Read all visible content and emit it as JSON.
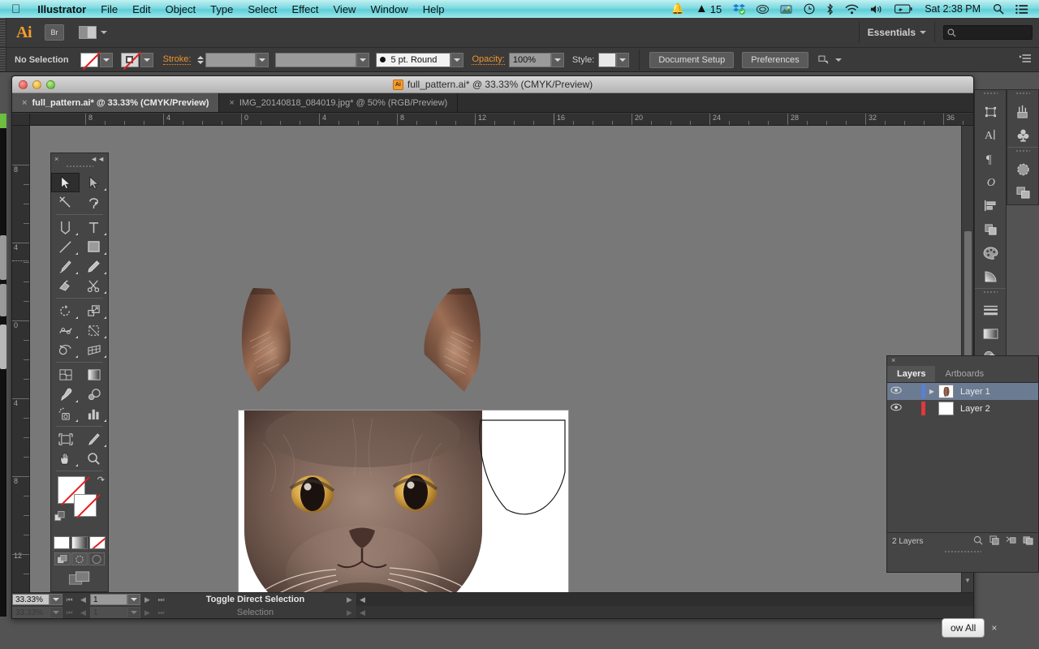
{
  "menubar": {
    "apple_icon": "apple-icon",
    "items": [
      {
        "label": "Illustrator",
        "bold": true
      },
      {
        "label": "File",
        "bold": false
      },
      {
        "label": "Edit",
        "bold": false
      },
      {
        "label": "Object",
        "bold": false
      },
      {
        "label": "Type",
        "bold": false
      },
      {
        "label": "Select",
        "bold": false
      },
      {
        "label": "Effect",
        "bold": false
      },
      {
        "label": "View",
        "bold": false
      },
      {
        "label": "Window",
        "bold": false
      },
      {
        "label": "Help",
        "bold": false
      }
    ],
    "status_icons": [
      "notification-bell-icon",
      "adobe-app-icon",
      "dropbox-icon",
      "creative-cloud-icon",
      "screenshot-app-icon",
      "time-machine-icon",
      "bluetooth-icon",
      "wifi-icon",
      "volume-icon",
      "battery-icon"
    ],
    "adobe_badge": "15",
    "clock": "Sat 2:38 PM",
    "search_icon": "spotlight-search-icon",
    "list_icon": "notification-center-icon",
    "accent_color": "#7fd9e0"
  },
  "appbar": {
    "logo": "Ai",
    "bridge_label": "Br",
    "arrange_icon": "arrange-documents-icon",
    "workspace": "Essentials",
    "search_placeholder": "",
    "search_icon": "search-icon"
  },
  "controlbar": {
    "selection_status": "No Selection",
    "fill_label": "fill-swatch-none",
    "stroke_swatch_label": "stroke-swatch-none",
    "stroke_label": "Stroke:",
    "stroke_weight": "",
    "stroke_profile": "",
    "brush_definition": "5 pt. Round",
    "opacity_label": "Opacity:",
    "opacity_value": "100%",
    "style_label": "Style:",
    "document_setup": "Document Setup",
    "preferences": "Preferences",
    "transform_icon": "transform-icon",
    "panel_menu_icon": "panel-menu-icon"
  },
  "document": {
    "title": "full_pattern.ai* @ 33.33% (CMYK/Preview)",
    "title_icon": "ai-document-icon",
    "tabs": [
      {
        "label": "full_pattern.ai* @ 33.33% (CMYK/Preview)",
        "active": true
      },
      {
        "label": "IMG_20140818_084019.jpg* @ 50% (RGB/Preview)",
        "active": false
      }
    ],
    "close_glyph": "×"
  },
  "rulers": {
    "horizontal_ticks": [
      "8",
      "4",
      "0",
      "4",
      "8",
      "12",
      "16",
      "20",
      "24",
      "28",
      "32",
      "36"
    ],
    "vertical_ticks": [
      "8",
      "4",
      "0",
      "4",
      "8",
      "12"
    ],
    "units": "inches"
  },
  "canvas": {
    "artboard_label": "artboard-1",
    "artwork": [
      {
        "name": "cat-left-ear",
        "type": "raster-image"
      },
      {
        "name": "cat-right-ear",
        "type": "raster-image"
      },
      {
        "name": "cat-face",
        "type": "clipped-raster-image"
      },
      {
        "name": "ear-outline-path",
        "type": "vector-path"
      }
    ]
  },
  "statusbar": {
    "zoom": "33.33%",
    "page": "1",
    "tool_hint": "Toggle Direct Selection",
    "tool_hint_secondary": "Selection",
    "nav_first": "first-page-icon",
    "nav_prev": "previous-page-icon",
    "nav_next": "next-page-icon",
    "nav_last": "last-page-icon"
  },
  "toolbox": {
    "close_glyph": "×",
    "collapse_glyph": "◄◄",
    "tools": [
      {
        "name": "selection-tool",
        "selected": true,
        "flyout": false
      },
      {
        "name": "direct-selection-tool",
        "selected": false,
        "flyout": true
      },
      {
        "name": "magic-wand-tool",
        "selected": false,
        "flyout": false
      },
      {
        "name": "lasso-tool",
        "selected": false,
        "flyout": false
      },
      {
        "name": "pen-tool",
        "selected": false,
        "flyout": true
      },
      {
        "name": "type-tool",
        "selected": false,
        "flyout": true
      },
      {
        "name": "line-segment-tool",
        "selected": false,
        "flyout": true
      },
      {
        "name": "rectangle-tool",
        "selected": false,
        "flyout": true
      },
      {
        "name": "paintbrush-tool",
        "selected": false,
        "flyout": true
      },
      {
        "name": "pencil-tool",
        "selected": false,
        "flyout": true
      },
      {
        "name": "blob-brush-tool",
        "selected": false,
        "flyout": false
      },
      {
        "name": "eraser-scissors-tool",
        "selected": false,
        "flyout": true
      },
      {
        "name": "rotate-tool",
        "selected": false,
        "flyout": true
      },
      {
        "name": "scale-tool",
        "selected": false,
        "flyout": true
      },
      {
        "name": "width-warp-tool",
        "selected": false,
        "flyout": true
      },
      {
        "name": "free-transform-tool",
        "selected": false,
        "flyout": true
      },
      {
        "name": "shape-builder-tool",
        "selected": false,
        "flyout": true
      },
      {
        "name": "perspective-grid-tool",
        "selected": false,
        "flyout": true
      },
      {
        "name": "mesh-tool",
        "selected": false,
        "flyout": false
      },
      {
        "name": "gradient-tool",
        "selected": false,
        "flyout": false
      },
      {
        "name": "eyedropper-tool",
        "selected": false,
        "flyout": true
      },
      {
        "name": "blend-tool",
        "selected": false,
        "flyout": false
      },
      {
        "name": "symbol-sprayer-tool",
        "selected": false,
        "flyout": true
      },
      {
        "name": "column-graph-tool",
        "selected": false,
        "flyout": true
      },
      {
        "name": "artboard-tool",
        "selected": false,
        "flyout": false
      },
      {
        "name": "slice-tool",
        "selected": false,
        "flyout": true
      },
      {
        "name": "hand-tool",
        "selected": false,
        "flyout": true
      },
      {
        "name": "zoom-tool",
        "selected": false,
        "flyout": false
      }
    ],
    "fill_swatch": "fill-none-swatch",
    "stroke_swatch": "stroke-none-swatch",
    "swap_icon": "swap-fill-stroke-icon",
    "default_icon": "default-fill-stroke-icon",
    "color_modes": [
      "color-swatch-button",
      "gradient-swatch-button",
      "none-swatch-button"
    ],
    "draw_modes": [
      "draw-normal-icon",
      "draw-behind-icon",
      "draw-inside-icon"
    ],
    "screen_mode": "change-screen-mode-icon"
  },
  "dock": {
    "column_a": [
      "transform-panel-icon",
      "character-panel-icon",
      "paragraph-panel-icon",
      "opentype-panel-icon",
      "align-panel-icon",
      "pathfinder-panel-icon",
      "color-panel-icon",
      "gradient-panel-icon",
      "stroke-panel-icon",
      "color-guide-panel-icon",
      "transparency-panel-icon"
    ],
    "column_b": [
      "brushes-panel-icon",
      "symbols-panel-icon",
      "appearance-panel-icon",
      "layers-panel-icon"
    ]
  },
  "layers_panel": {
    "close_glyph": "×",
    "tabs": [
      {
        "label": "Layers",
        "active": true
      },
      {
        "label": "Artboards",
        "active": false
      }
    ],
    "rows": [
      {
        "name": "Layer 1",
        "color": "#5b7fd4",
        "selected": true,
        "visible": true,
        "has_disclosure": true,
        "thumb": "cat-art-thumbnail"
      },
      {
        "name": "Layer 2",
        "color": "#e0393b",
        "selected": false,
        "visible": true,
        "has_disclosure": false,
        "thumb": "blank-thumbnail"
      }
    ],
    "footer_count": "2 Layers",
    "footer_icons": [
      "locate-object-icon",
      "make-clipping-mask-icon",
      "create-new-sublayer-icon",
      "create-new-layer-icon",
      "delete-selection-icon"
    ]
  },
  "notification": {
    "show_all_label": "ow All",
    "close_glyph": "×"
  }
}
